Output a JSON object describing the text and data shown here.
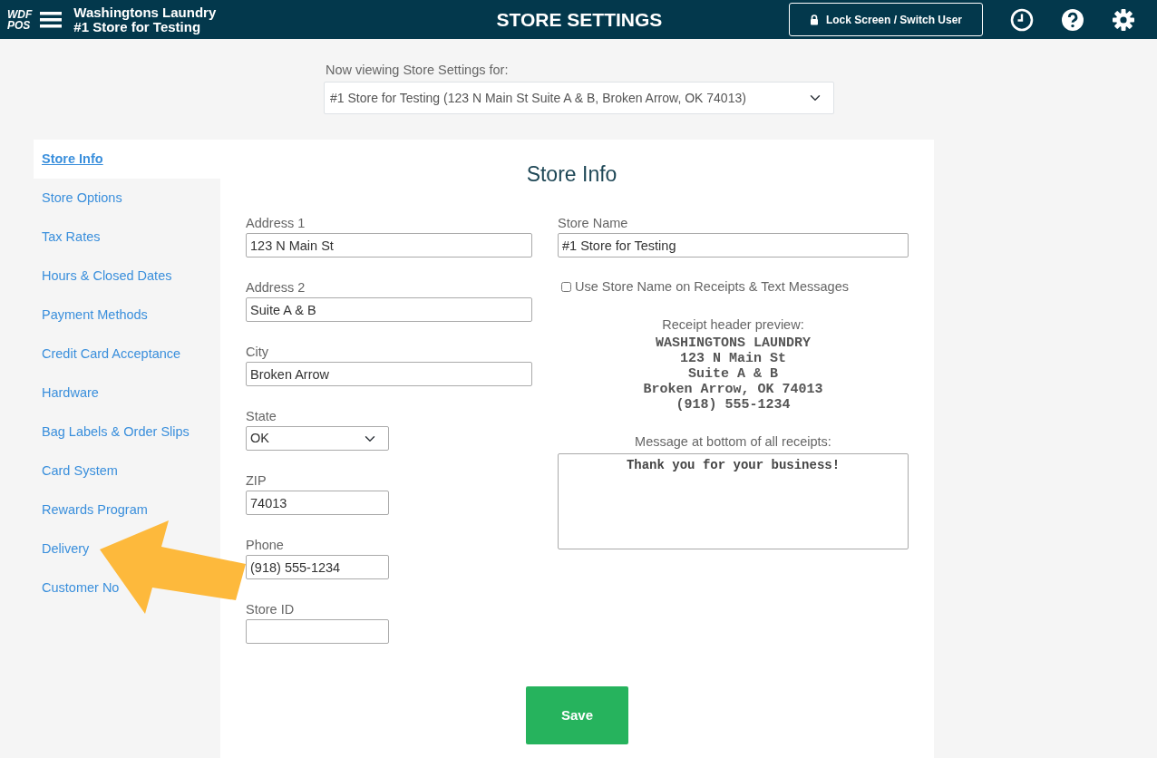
{
  "header": {
    "logo": [
      "WDF",
      "POS"
    ],
    "company": "Washingtons Laundry",
    "store": "#1 Store for Testing",
    "title": "STORE SETTINGS",
    "lock_button": "Lock Screen / Switch User"
  },
  "store_selector": {
    "label": "Now viewing Store Settings for:",
    "value": "#1 Store for Testing (123 N Main St Suite A & B, Broken Arrow, OK 74013)"
  },
  "sidebar": {
    "items": [
      {
        "label": "Store Info",
        "selected": true
      },
      {
        "label": "Store Options",
        "selected": false
      },
      {
        "label": "Tax Rates",
        "selected": false
      },
      {
        "label": "Hours & Closed Dates",
        "selected": false
      },
      {
        "label": "Payment Methods",
        "selected": false
      },
      {
        "label": "Credit Card Acceptance",
        "selected": false
      },
      {
        "label": "Hardware",
        "selected": false
      },
      {
        "label": "Bag Labels & Order Slips",
        "selected": false
      },
      {
        "label": "Card System",
        "selected": false
      },
      {
        "label": "Rewards Program",
        "selected": false
      },
      {
        "label": "Delivery",
        "selected": false
      },
      {
        "label": "Customer No",
        "selected": false
      }
    ]
  },
  "form": {
    "title": "Store Info",
    "left_fields": [
      {
        "label": "Address 1",
        "value": "123 N Main St",
        "kind": "text"
      },
      {
        "label": "Address 2",
        "value": "Suite A & B",
        "kind": "text"
      },
      {
        "label": "City",
        "value": "Broken Arrow",
        "kind": "text"
      },
      {
        "label": "State",
        "value": "OK",
        "kind": "select"
      },
      {
        "label": "ZIP",
        "value": "74013",
        "kind": "text"
      },
      {
        "label": "Phone",
        "value": "(918) 555-1234",
        "kind": "text"
      },
      {
        "label": "Store ID",
        "kind": "text"
      }
    ],
    "store_name": {
      "label": "Store Name",
      "value": "#1 Store for Testing"
    },
    "use_store_name": {
      "label": "Use Store Name on Receipts & Text Messages",
      "checked": false
    },
    "preview_label": "Receipt header preview:",
    "preview_lines": [
      "WASHINGTONS LAUNDRY",
      "123 N Main St",
      "Suite A & B",
      "Broken Arrow, OK 74013",
      "(918) 555-1234"
    ],
    "message_label": "Message at bottom of all receipts:",
    "message": "Thank you for your business!",
    "save_button": "Save"
  }
}
